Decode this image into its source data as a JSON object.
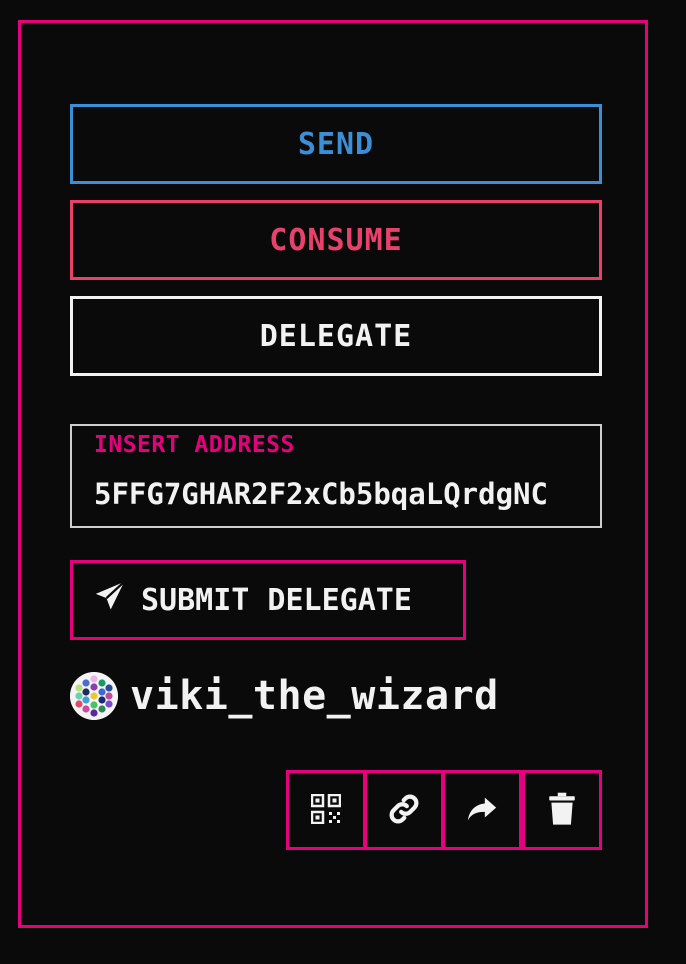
{
  "actions": {
    "send_label": "SEND",
    "consume_label": "CONSUME",
    "delegate_label": "DELEGATE"
  },
  "address": {
    "label": "INSERT ADDRESS",
    "value": "5FFG7GHAR2F2xCb5bqaLQrdgNC"
  },
  "submit": {
    "label": "SUBMIT DELEGATE",
    "icon": "paper-plane-icon"
  },
  "account": {
    "username": "viki_the_wizard",
    "avatar_icon": "identicon-avatar"
  },
  "toolbar": {
    "icons": [
      "qr-code-icon",
      "link-icon",
      "share-icon",
      "trash-icon"
    ]
  },
  "colors": {
    "accent": "#e6007e",
    "send": "#3a8fd6",
    "consume": "#e8416b",
    "text": "#f2f2f2",
    "background": "#0a0a0a"
  }
}
